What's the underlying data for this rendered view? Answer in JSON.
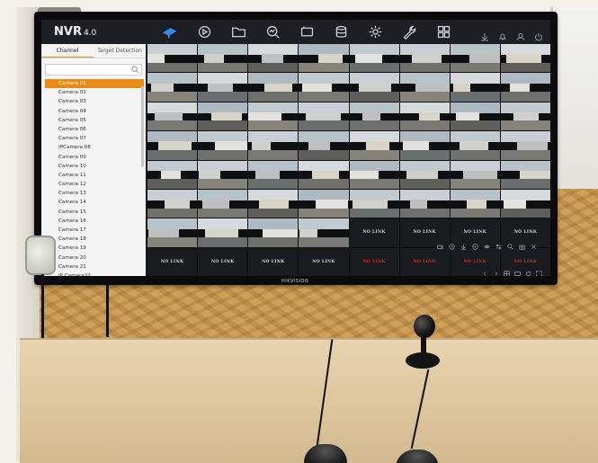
{
  "app": {
    "logo": "NVR",
    "version": "4.0",
    "brand": "HIKVISION"
  },
  "topbar": {
    "icons": [
      {
        "name": "live-view-icon",
        "active": true
      },
      {
        "name": "playback-icon",
        "active": false
      },
      {
        "name": "file-management-icon",
        "active": false
      },
      {
        "name": "smart-analysis-icon",
        "active": false
      },
      {
        "name": "configuration-icon",
        "active": false
      },
      {
        "name": "storage-icon",
        "active": false
      },
      {
        "name": "system-settings-icon",
        "active": false
      },
      {
        "name": "maintenance-icon",
        "active": false
      },
      {
        "name": "app-grid-icon",
        "active": false
      }
    ],
    "right_icons": [
      "download-icon",
      "alarm-bell-icon",
      "account-icon",
      "power-icon"
    ]
  },
  "sidebar": {
    "tabs": [
      {
        "label": "Channel",
        "active": true
      },
      {
        "label": "Target Detection",
        "active": false
      }
    ],
    "search": {
      "placeholder": "",
      "value": ""
    },
    "channels": [
      "Camera 01",
      "Camera 02",
      "Camera 03",
      "Camera 04",
      "Camera 05",
      "Camera 06",
      "Camera 07",
      "IPCamera 08",
      "Camera 09",
      "Camera 10",
      "Camera 11",
      "Camera 12",
      "Camera 13",
      "Camera 14",
      "Camera 15",
      "Camera 16",
      "Camera 17",
      "Camera 18",
      "Camera 19",
      "Camera 20",
      "Camera 21",
      "IP Camera22",
      "IP Camera23"
    ],
    "selected_index": 0
  },
  "grid": {
    "layout": "8x8",
    "nolink_text": "NO LINK",
    "nolink_row1": [
      "NO LINK",
      "NO LINK",
      "NO LINK",
      "NO LINK"
    ],
    "nolink_row2": [
      "NO LINK",
      "NO LINK",
      "NO LINK",
      "NO LINK",
      "NO LINK",
      "NO LINK",
      "NO LINK",
      "NO LINK"
    ]
  },
  "colors": {
    "accent": "#e88a16",
    "active_icon": "#2f8af5",
    "nolink_alert": "#d22b2b"
  }
}
